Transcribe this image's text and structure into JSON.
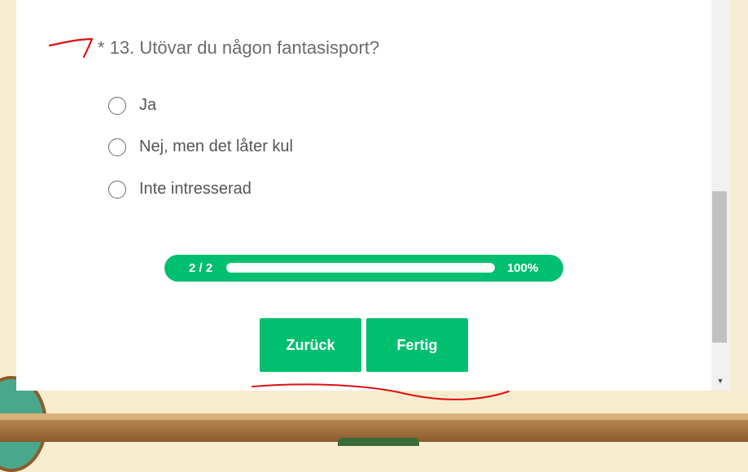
{
  "question": {
    "required_marker": "*",
    "text": "13. Utövar du någon fantasisport?"
  },
  "options": [
    {
      "label": "Ja",
      "selected": false
    },
    {
      "label": "Nej, men det låter kul",
      "selected": false
    },
    {
      "label": "Inte intresserad",
      "selected": false
    }
  ],
  "progress": {
    "count_label": "2 / 2",
    "percent_label": "100%",
    "fraction": 1.0
  },
  "buttons": {
    "back_label": "Zurück",
    "done_label": "Fertig"
  },
  "colors": {
    "accent": "#00bf6f",
    "annotation": "#e01010"
  }
}
